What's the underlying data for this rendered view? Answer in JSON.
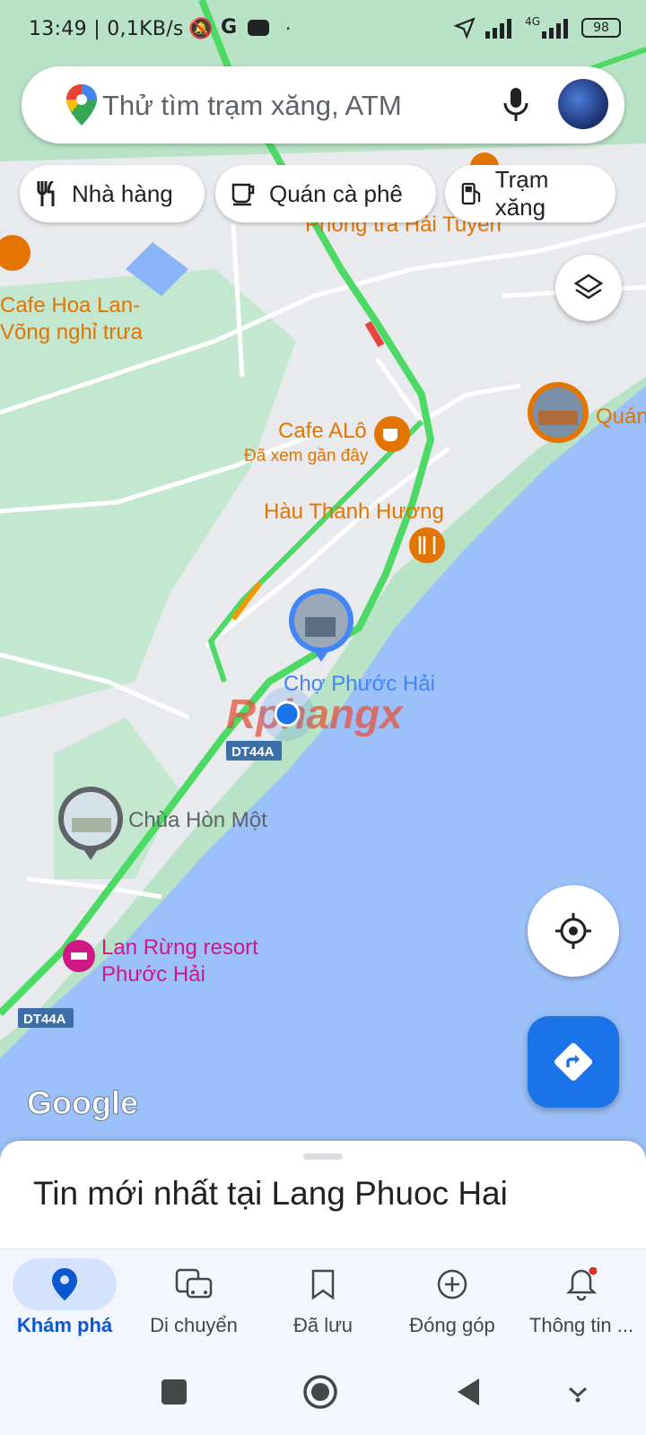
{
  "status_bar": {
    "left_text": "13:49 | 0,1KB/s",
    "network": "4G",
    "battery": "98"
  },
  "search": {
    "placeholder": "Thử tìm trạm xăng, ATM"
  },
  "chips": [
    {
      "label": "Nhà hàng",
      "icon": "restaurant-icon"
    },
    {
      "label": "Quán cà phê",
      "icon": "coffee-icon"
    },
    {
      "label": "Trạm xăng",
      "icon": "gas-station-icon"
    }
  ],
  "map": {
    "places": [
      {
        "name": "Phòng trà Hải Tuyền"
      },
      {
        "name": "Cafe Hoa Lan-",
        "name2": "Võng nghỉ trưa"
      },
      {
        "name": "Cafe ALô",
        "subtitle": "Đã xem gần đây"
      },
      {
        "name": "Quán"
      },
      {
        "name": "Hàu Thanh Hương"
      },
      {
        "name": "Chợ Phước Hải"
      },
      {
        "name": "Chùa Hòn Một"
      },
      {
        "name": "Lan Rừng resort",
        "name2": "Phước Hải"
      }
    ],
    "road_labels": [
      "DT44A",
      "DT44A"
    ],
    "watermark": "Rphangx",
    "logo": "Google",
    "colors": {
      "land": "#e8eaed",
      "park": "#b9e3c6",
      "water": "#9cc0f9",
      "traffic": "#4cd964",
      "poi_orange": "#e37400",
      "poi_pink": "#d01884"
    }
  },
  "sheet": {
    "title": "Tin mới nhất tại Lang Phuoc Hai"
  },
  "nav": [
    {
      "label": "Khám phá",
      "icon": "location-pin-icon",
      "active": true
    },
    {
      "label": "Di chuyển",
      "icon": "commute-icon",
      "active": false
    },
    {
      "label": "Đã lưu",
      "icon": "bookmark-icon",
      "active": false
    },
    {
      "label": "Đóng góp",
      "icon": "add-circle-icon",
      "active": false
    },
    {
      "label": "Thông tin ...",
      "icon": "bell-icon",
      "active": false
    }
  ]
}
